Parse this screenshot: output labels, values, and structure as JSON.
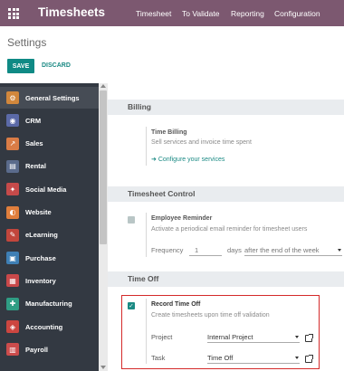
{
  "topbar": {
    "app_name": "Timesheets",
    "menu": [
      "Timesheet",
      "To Validate",
      "Reporting",
      "Configuration"
    ]
  },
  "control_panel": {
    "title": "Settings",
    "save_label": "SAVE",
    "discard_label": "DISCARD"
  },
  "sidebar": {
    "items": [
      {
        "label": "General Settings",
        "icon": "gear-icon",
        "color": "#d1873c"
      },
      {
        "label": "CRM",
        "icon": "crm-icon",
        "color": "#5b6aa8"
      },
      {
        "label": "Sales",
        "icon": "sales-icon",
        "color": "#d97c46"
      },
      {
        "label": "Rental",
        "icon": "rental-icon",
        "color": "#5a6b8c"
      },
      {
        "label": "Social Media",
        "icon": "social-media-icon",
        "color": "#c54a4a"
      },
      {
        "label": "Website",
        "icon": "website-icon",
        "color": "#e07e3c"
      },
      {
        "label": "eLearning",
        "icon": "elearning-icon",
        "color": "#c2463c"
      },
      {
        "label": "Purchase",
        "icon": "purchase-icon",
        "color": "#3e7fb5"
      },
      {
        "label": "Inventory",
        "icon": "inventory-icon",
        "color": "#c9484a"
      },
      {
        "label": "Manufacturing",
        "icon": "manufacturing-icon",
        "color": "#2f9d84"
      },
      {
        "label": "Accounting",
        "icon": "accounting-icon",
        "color": "#cc4640"
      },
      {
        "label": "Payroll",
        "icon": "payroll-icon",
        "color": "#cc4c4c"
      }
    ],
    "active_index": 0
  },
  "billing": {
    "header": "Billing",
    "title": "Time Billing",
    "desc": "Sell services and invoice time spent",
    "link": "Configure your services"
  },
  "timesheet_control": {
    "header": "Timesheet Control",
    "title": "Employee Reminder",
    "desc": "Activate a periodical email reminder for timesheet users",
    "frequency_label": "Frequency",
    "frequency_value": "1",
    "frequency_unit": "days",
    "frequency_option": "after the end of the week"
  },
  "time_off": {
    "header": "Time Off",
    "title": "Record Time Off",
    "desc": "Create timesheets upon time off validation",
    "project_label": "Project",
    "project_value": "Internal Project",
    "task_label": "Task",
    "task_value": "Time Off",
    "checked": true
  },
  "colors": {
    "topbar": "#7c5870",
    "primary": "#0f8a85",
    "sidebar": "#333942",
    "highlight": "#d42a2a"
  }
}
